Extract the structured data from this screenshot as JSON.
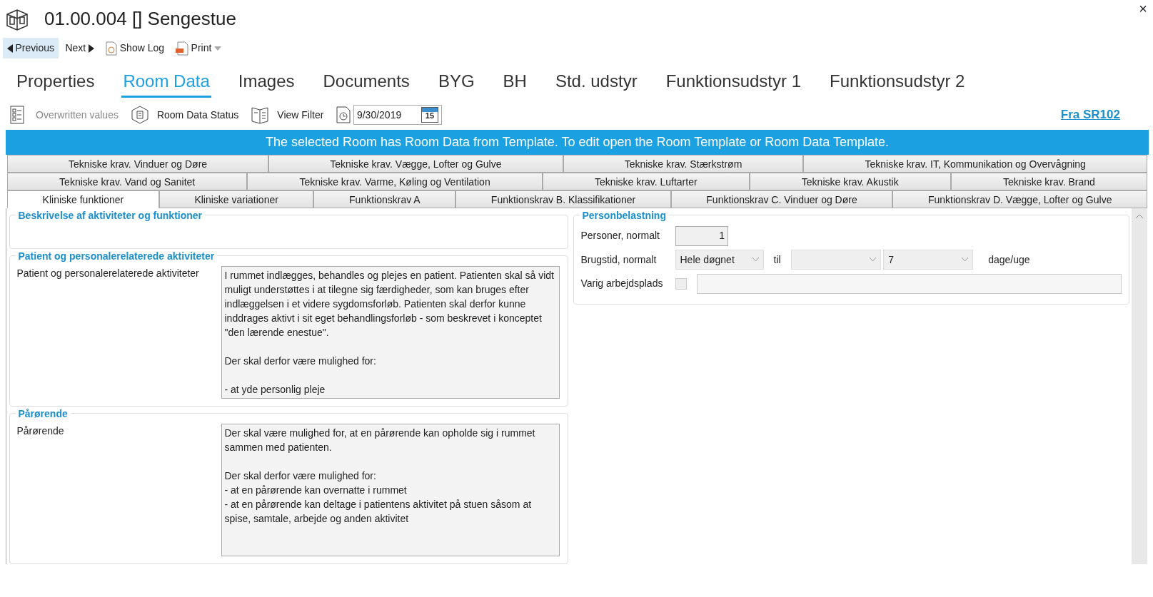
{
  "window": {
    "title": "01.00.004 [] Sengestue",
    "close": "×"
  },
  "toolbar": [
    {
      "kind": "prev",
      "label": "Previous",
      "highlighted": true
    },
    {
      "kind": "next",
      "label": "Next",
      "highlighted": false
    },
    {
      "kind": "log",
      "label": "Show Log",
      "highlighted": false
    },
    {
      "kind": "print",
      "label": "Print",
      "highlighted": false
    }
  ],
  "main_tabs": [
    {
      "label": "Properties",
      "selected": false
    },
    {
      "label": "Room Data",
      "selected": true
    },
    {
      "label": "Images",
      "selected": false
    },
    {
      "label": "Documents",
      "selected": false
    },
    {
      "label": "BYG",
      "selected": false
    },
    {
      "label": "BH",
      "selected": false
    },
    {
      "label": "Std. udstyr",
      "selected": false
    },
    {
      "label": "Funktionsudstyr 1",
      "selected": false
    },
    {
      "label": "Funktionsudstyr 2",
      "selected": false
    }
  ],
  "sub_toolbar": [
    {
      "kind": "overwritten",
      "label": "Overwritten values",
      "disabled": true
    },
    {
      "kind": "status",
      "label": "Room Data Status",
      "disabled": false
    },
    {
      "kind": "filter",
      "label": "View Filter",
      "disabled": false
    }
  ],
  "date": {
    "value": "9/30/2019",
    "calendar_day": "15"
  },
  "source_link": "Fra SR102",
  "banner": "The selected Room has Room Data from Template. To edit open the Room Template or Room Data Template.",
  "sub_tabs": [
    [
      {
        "label": "Tekniske krav. Vinduer og Døre",
        "selected": false
      },
      {
        "label": "Tekniske krav. Vægge, Lofter og Gulve",
        "selected": false
      },
      {
        "label": "Tekniske krav. Stærkstrøm",
        "selected": false
      },
      {
        "label": "Tekniske krav. IT, Kommunikation og Overvågning",
        "selected": false
      }
    ],
    [
      {
        "label": "Tekniske krav. Vand og Sanitet",
        "selected": false
      },
      {
        "label": "Tekniske krav. Varme, Køling og Ventilation",
        "selected": false
      },
      {
        "label": "Tekniske krav. Luftarter",
        "selected": false
      },
      {
        "label": "Tekniske krav. Akustik",
        "selected": false
      },
      {
        "label": "Tekniske krav. Brand",
        "selected": false
      }
    ],
    [
      {
        "label": "Kliniske funktioner",
        "selected": true
      },
      {
        "label": "Kliniske variationer",
        "selected": false
      },
      {
        "label": "Funktionskrav A",
        "selected": false
      },
      {
        "label": "Funktionskrav B. Klassifikationer",
        "selected": false
      },
      {
        "label": "Funktionskrav C. Vinduer og Døre",
        "selected": false
      },
      {
        "label": "Funktionskrav D. Vægge, Lofter og Gulve",
        "selected": false
      }
    ]
  ],
  "left_groups": [
    {
      "title": "Beskrivelse af aktiviteter og funktioner"
    },
    {
      "title": "Patient og personalerelaterede aktiviteter",
      "fields": [
        {
          "label": "Patient og personalerelaterede aktiviteter",
          "value": "I rummet indlægges, behandles og plejes en patient. Patienten skal så vidt muligt understøttes i at tilegne sig færdigheder, som kan bruges efter indlæggelsen i et videre sygdomsforløb. Patienten skal derfor kunne inddrages aktivt i sit eget behandlingsforløb - som beskrevet i konceptet \"den lærende enestue\".\n\nDer skal derfor være mulighed for:\n\n- at yde personlig pleje"
        }
      ]
    },
    {
      "title": "Pårørende",
      "fields": [
        {
          "label": "Pårørende",
          "value": "Der skal være mulighed for, at en pårørende kan opholde sig i rummet sammen med patienten.\n\nDer skal derfor være mulighed for:\n- at en pårørende kan overnatte i rummet\n- at en pårørende kan deltage i patientens aktivitet på stuen såsom at spise, samtale, arbejde og anden aktivitet"
        }
      ]
    }
  ],
  "right_group": {
    "title": "Personbelastning",
    "fields": [
      {
        "kind": "number",
        "label": "Personer, normalt",
        "value": "1"
      },
      {
        "kind": "range",
        "label": "Brugstid, normalt",
        "from": "Hele døgnet",
        "separator": "til",
        "days": "7",
        "unit": "dage/uge"
      },
      {
        "kind": "checkbox",
        "label": "Varig arbejdsplads",
        "checked": false
      }
    ]
  }
}
